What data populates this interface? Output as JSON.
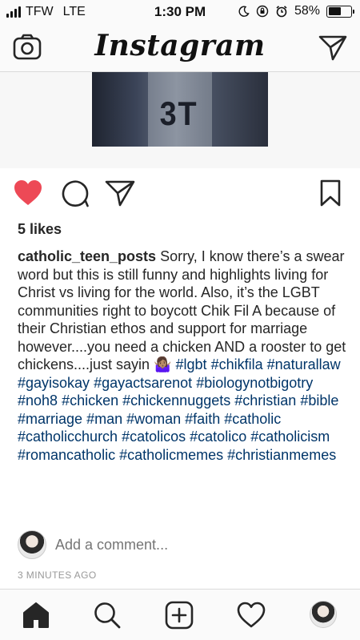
{
  "status_bar": {
    "carrier": "TFW",
    "network": "LTE",
    "time": "1:30 PM",
    "battery": "58%",
    "battery_level": 0.58
  },
  "header": {
    "logo": "Instagram",
    "left_icon": "camera-icon",
    "right_icon": "direct-message-icon"
  },
  "post": {
    "media_text": "3T",
    "liked": true,
    "like_color": "#ed4956",
    "likes": "5 likes",
    "username": "catholic_teen_posts",
    "caption_text": "Sorry, I know there’s a swear word but this is still funny and highlights living for Christ vs living for the world. Also, it’s the LGBT communities right to boycott Chik Fil A because of their Christian ethos and support for marriage however....you need a chicken AND a rooster to get chickens....just sayin 🤷🏽‍♀️",
    "hashtags": [
      "#lgbt",
      "#chikfila",
      "#naturallaw",
      "#gayisokay",
      "#gayactsarenot",
      "#biologynotbigotry",
      "#noh8",
      "#chicken",
      "#chickennuggets",
      "#christian",
      "#bible",
      "#marriage",
      "#man",
      "#woman",
      "#faith",
      "#catholic",
      "#catholicchurch",
      "#catolicos",
      "#catolico",
      "#catholicism",
      "#romancatholic",
      "#catholicmemes",
      "#christianmemes"
    ],
    "hashtag_color": "#003569",
    "comment_placeholder": "Add a comment...",
    "timestamp": "3 MINUTES AGO"
  },
  "tab_bar": {
    "items": [
      "home-icon",
      "search-icon",
      "add-post-icon",
      "activity-icon",
      "profile-avatar"
    ],
    "active": "home-icon"
  }
}
